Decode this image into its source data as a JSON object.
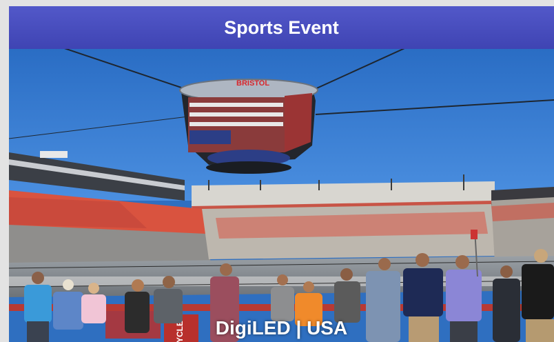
{
  "header": {
    "title": "Sports Event"
  },
  "photo": {
    "scoreboard_logo": "BRISTOL",
    "trash_can_text": "YCLE"
  },
  "caption": {
    "text": "DigiLED | USA"
  },
  "colors": {
    "header": "#4a4fc0",
    "sky": "#2f6fc0",
    "seats_red": "#d94a3a",
    "text": "#ffffff"
  }
}
